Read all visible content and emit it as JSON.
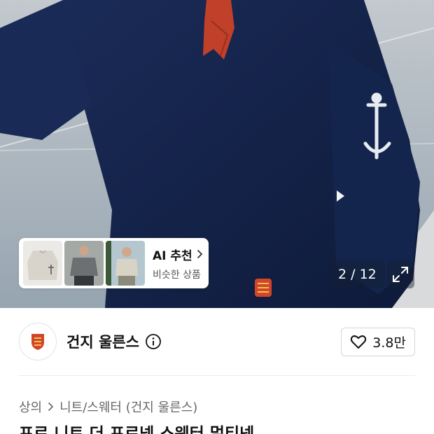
{
  "gallery": {
    "current": 2,
    "total": 12,
    "counter_text": "2 / 12"
  },
  "ai_recommend": {
    "title": "AI 추천",
    "subtitle": "비슷한 상품"
  },
  "brand": {
    "name": "건지 울른스",
    "likes": "3.8만"
  },
  "breadcrumb": {
    "items": [
      "상의",
      "니트/스웨터 (건지 울른스)"
    ]
  },
  "product": {
    "title": "프로 니트 더 프로넥 스웨터 멀티넷"
  },
  "colors": {
    "sweater": "#13234a",
    "scarf": "#c0402a",
    "emblem": "#d1452c"
  },
  "icons": [
    "play-arrow-icon",
    "expand-icon",
    "brand-logo-icon",
    "info-icon",
    "heart-icon",
    "chevron-right-icon"
  ]
}
